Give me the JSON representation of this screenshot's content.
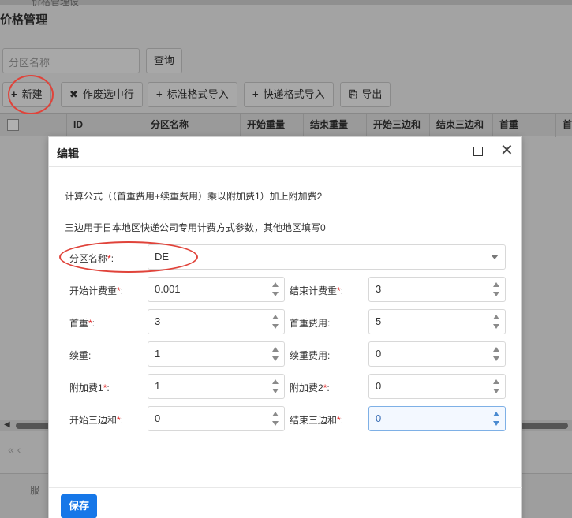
{
  "background": {
    "top_tab": "价格管理设",
    "title": "价格管理",
    "search_placeholder": "分区名称",
    "query_button": "查询",
    "toolbar": [
      {
        "icon": "plus-icon",
        "glyph": "+",
        "label": "新建"
      },
      {
        "icon": "close-icon",
        "glyph": "✖",
        "label": "作废选中行"
      },
      {
        "icon": "plus-icon",
        "glyph": "+",
        "label": "标准格式导入"
      },
      {
        "icon": "plus-icon",
        "glyph": "+",
        "label": "快递格式导入"
      },
      {
        "icon": "export-icon",
        "glyph": "⎘",
        "label": "导出"
      }
    ],
    "columns": [
      "ID",
      "分区名称",
      "开始重量",
      "结束重量",
      "开始三边和",
      "结束三边和",
      "首重",
      "首"
    ],
    "pager_glyphs": "«  ‹",
    "footer_item": "服"
  },
  "modal": {
    "title": "编辑",
    "note1": "计算公式（（首重费用+续重费用）乘以附加费1）加上附加费2",
    "note2": "三边用于日本地区快递公司专用计费方式参数，其他地区填写0",
    "zone": {
      "label": "分区名称",
      "value": "DE"
    },
    "fields": [
      {
        "label": "开始计费重",
        "required": true,
        "value": "0.001"
      },
      {
        "label": "结束计费重",
        "required": true,
        "value": "3"
      },
      {
        "label": "首重",
        "required": true,
        "value": "3"
      },
      {
        "label": "首重费用",
        "required": false,
        "value": "5"
      },
      {
        "label": "续重",
        "required": false,
        "value": "1"
      },
      {
        "label": "续重费用",
        "required": false,
        "value": "0"
      },
      {
        "label": "附加费1",
        "required": true,
        "value": "1"
      },
      {
        "label": "附加费2",
        "required": true,
        "value": "0"
      },
      {
        "label": "开始三边和",
        "required": true,
        "value": "0"
      },
      {
        "label": "结束三边和",
        "required": true,
        "value": "0"
      }
    ],
    "save_label": "保存"
  },
  "colors": {
    "primary": "#1677e8",
    "required": "#e02020",
    "annotation": "#e0433a"
  }
}
